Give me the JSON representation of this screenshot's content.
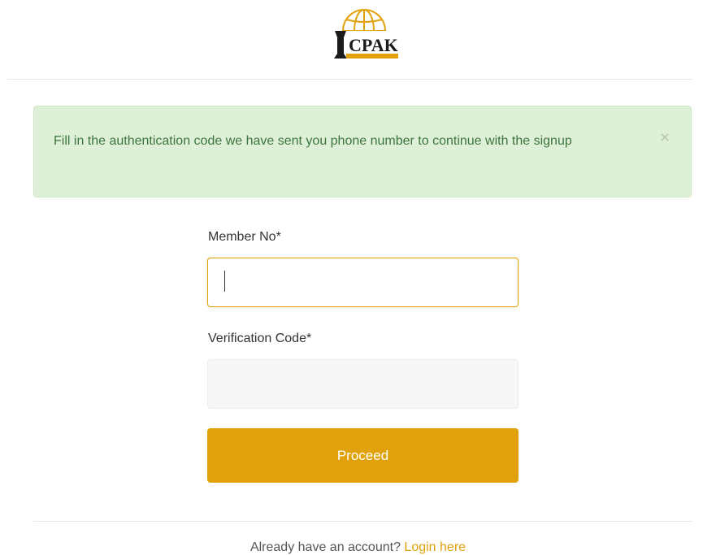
{
  "brand": {
    "logo_text": "CPAK",
    "accent_color": "#e0a10a",
    "alert_text_color": "#3c763d",
    "alert_bg_color": "#dff0d8"
  },
  "alert": {
    "message": "Fill in the authentication code we have sent you phone number to continue with the signup",
    "close_icon": "×"
  },
  "form": {
    "member_no_label": "Member No*",
    "member_no_value": "",
    "verification_code_label": "Verification Code*",
    "verification_code_value": "",
    "submit_label": "Proceed"
  },
  "footer": {
    "prompt": "Already have an account?",
    "link_text": "Login here"
  }
}
